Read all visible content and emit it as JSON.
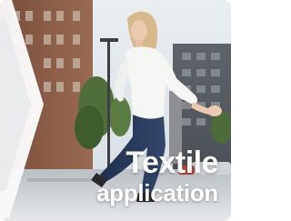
{
  "card": {
    "title_line1": "Textile",
    "title_line2": "application",
    "photo": "woman-in-white-blouse-and-jeans-on-city-street",
    "chevron_icon": "chevron-right-icon"
  },
  "colors": {
    "text": "#ffffff",
    "chevron": "#ffffff",
    "sky": "#dfe6ea",
    "brick": "#8a5a44"
  }
}
